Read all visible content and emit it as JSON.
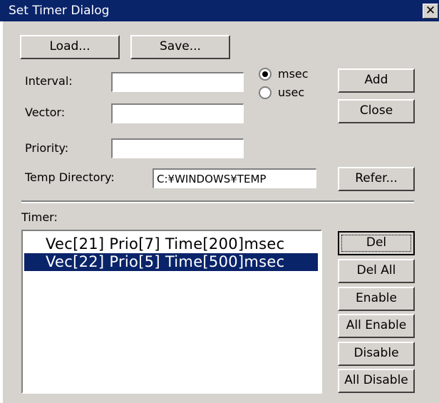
{
  "window": {
    "title": "Set Timer Dialog",
    "close_glyph": "✕"
  },
  "toolbar": {
    "load_label": "Load...",
    "save_label": "Save..."
  },
  "form": {
    "interval_label": "Interval:",
    "interval_value": "",
    "vector_label": "Vector:",
    "vector_value": "",
    "priority_label": "Priority:",
    "priority_value": "",
    "temp_dir_label": "Temp Directory:",
    "temp_dir_value": "C:¥WINDOWS¥TEMP"
  },
  "units": {
    "msec_label": "msec",
    "usec_label": "usec",
    "selected": "msec"
  },
  "buttons": {
    "add": "Add",
    "close": "Close",
    "refer": "Refer...",
    "del": "Del",
    "del_all": "Del All",
    "enable": "Enable",
    "all_enable": "All Enable",
    "disable": "Disable",
    "all_disable": "All Disable"
  },
  "timer": {
    "label": "Timer:",
    "items": [
      {
        "text": "Vec[21] Prio[7] Time[200]msec",
        "selected": false
      },
      {
        "text": "Vec[22] Prio[5] Time[500]msec",
        "selected": true
      }
    ]
  },
  "colors": {
    "title_bar": "#0a246a",
    "dialog_bg": "#d6d3ce",
    "selection": "#0a246a"
  }
}
